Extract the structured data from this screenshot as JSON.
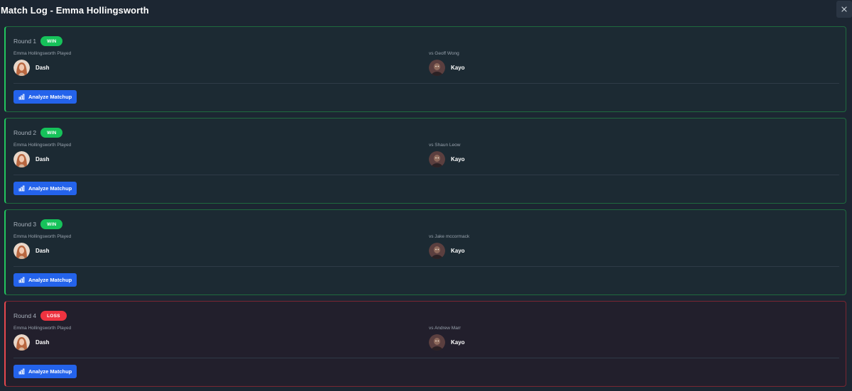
{
  "modal": {
    "title": "Match Log - Emma Hollingsworth",
    "close_icon": "close-icon"
  },
  "colors": {
    "win_accent": "#22c55e",
    "loss_accent": "#e5484d",
    "button_blue": "#2463eb"
  },
  "rounds": [
    {
      "label": "Round 1",
      "result": "WIN",
      "played_label": "Emma Hollingsworth Played",
      "player_agent": "Dash",
      "opponent_label": "vs Geoff Wong",
      "opponent_agent": "Kayo",
      "analyze_label": "Analyze Matchup"
    },
    {
      "label": "Round 2",
      "result": "WIN",
      "played_label": "Emma Hollingsworth Played",
      "player_agent": "Dash",
      "opponent_label": "vs Shaun Leow",
      "opponent_agent": "Kayo",
      "analyze_label": "Analyze Matchup"
    },
    {
      "label": "Round 3",
      "result": "WIN",
      "played_label": "Emma Hollingsworth Played",
      "player_agent": "Dash",
      "opponent_label": "vs Jake mccormack",
      "opponent_agent": "Kayo",
      "analyze_label": "Analyze Matchup"
    },
    {
      "label": "Round 4",
      "result": "LOSS",
      "played_label": "Emma Hollingsworth Played",
      "player_agent": "Dash",
      "opponent_label": "vs Andrew Marr",
      "opponent_agent": "Kayo",
      "analyze_label": "Analyze Matchup"
    }
  ]
}
